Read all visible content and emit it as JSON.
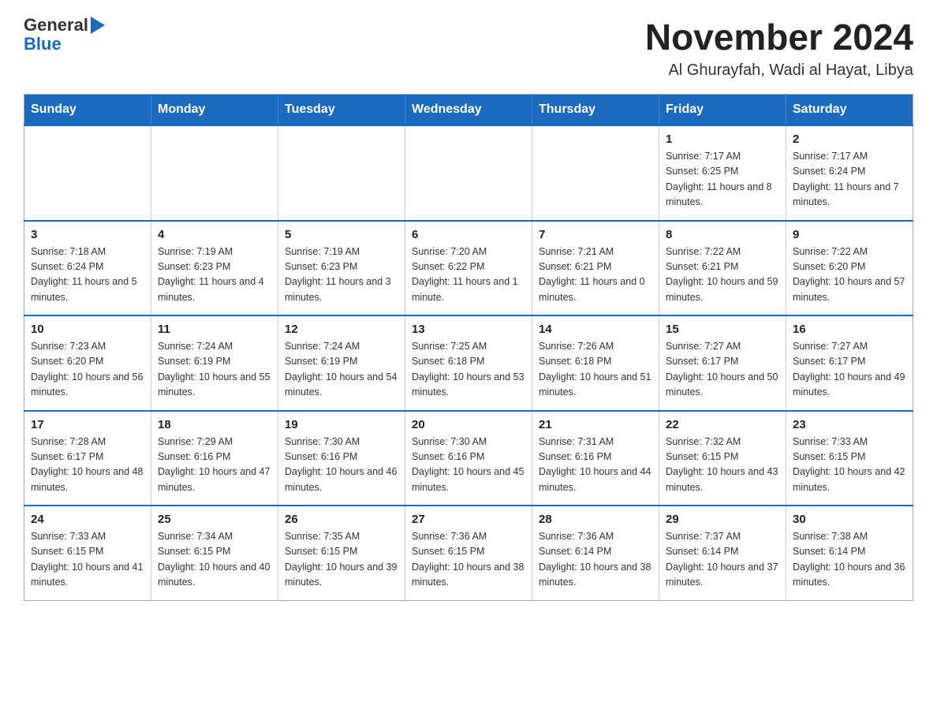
{
  "header": {
    "logo_general": "General",
    "logo_triangle": "▶",
    "logo_blue": "Blue",
    "month_title": "November 2024",
    "location": "Al Ghurayfah, Wadi al Hayat, Libya"
  },
  "weekdays": [
    "Sunday",
    "Monday",
    "Tuesday",
    "Wednesday",
    "Thursday",
    "Friday",
    "Saturday"
  ],
  "weeks": [
    [
      {
        "day": "",
        "info": ""
      },
      {
        "day": "",
        "info": ""
      },
      {
        "day": "",
        "info": ""
      },
      {
        "day": "",
        "info": ""
      },
      {
        "day": "",
        "info": ""
      },
      {
        "day": "1",
        "info": "Sunrise: 7:17 AM\nSunset: 6:25 PM\nDaylight: 11 hours and 8 minutes."
      },
      {
        "day": "2",
        "info": "Sunrise: 7:17 AM\nSunset: 6:24 PM\nDaylight: 11 hours and 7 minutes."
      }
    ],
    [
      {
        "day": "3",
        "info": "Sunrise: 7:18 AM\nSunset: 6:24 PM\nDaylight: 11 hours and 5 minutes."
      },
      {
        "day": "4",
        "info": "Sunrise: 7:19 AM\nSunset: 6:23 PM\nDaylight: 11 hours and 4 minutes."
      },
      {
        "day": "5",
        "info": "Sunrise: 7:19 AM\nSunset: 6:23 PM\nDaylight: 11 hours and 3 minutes."
      },
      {
        "day": "6",
        "info": "Sunrise: 7:20 AM\nSunset: 6:22 PM\nDaylight: 11 hours and 1 minute."
      },
      {
        "day": "7",
        "info": "Sunrise: 7:21 AM\nSunset: 6:21 PM\nDaylight: 11 hours and 0 minutes."
      },
      {
        "day": "8",
        "info": "Sunrise: 7:22 AM\nSunset: 6:21 PM\nDaylight: 10 hours and 59 minutes."
      },
      {
        "day": "9",
        "info": "Sunrise: 7:22 AM\nSunset: 6:20 PM\nDaylight: 10 hours and 57 minutes."
      }
    ],
    [
      {
        "day": "10",
        "info": "Sunrise: 7:23 AM\nSunset: 6:20 PM\nDaylight: 10 hours and 56 minutes."
      },
      {
        "day": "11",
        "info": "Sunrise: 7:24 AM\nSunset: 6:19 PM\nDaylight: 10 hours and 55 minutes."
      },
      {
        "day": "12",
        "info": "Sunrise: 7:24 AM\nSunset: 6:19 PM\nDaylight: 10 hours and 54 minutes."
      },
      {
        "day": "13",
        "info": "Sunrise: 7:25 AM\nSunset: 6:18 PM\nDaylight: 10 hours and 53 minutes."
      },
      {
        "day": "14",
        "info": "Sunrise: 7:26 AM\nSunset: 6:18 PM\nDaylight: 10 hours and 51 minutes."
      },
      {
        "day": "15",
        "info": "Sunrise: 7:27 AM\nSunset: 6:17 PM\nDaylight: 10 hours and 50 minutes."
      },
      {
        "day": "16",
        "info": "Sunrise: 7:27 AM\nSunset: 6:17 PM\nDaylight: 10 hours and 49 minutes."
      }
    ],
    [
      {
        "day": "17",
        "info": "Sunrise: 7:28 AM\nSunset: 6:17 PM\nDaylight: 10 hours and 48 minutes."
      },
      {
        "day": "18",
        "info": "Sunrise: 7:29 AM\nSunset: 6:16 PM\nDaylight: 10 hours and 47 minutes."
      },
      {
        "day": "19",
        "info": "Sunrise: 7:30 AM\nSunset: 6:16 PM\nDaylight: 10 hours and 46 minutes."
      },
      {
        "day": "20",
        "info": "Sunrise: 7:30 AM\nSunset: 6:16 PM\nDaylight: 10 hours and 45 minutes."
      },
      {
        "day": "21",
        "info": "Sunrise: 7:31 AM\nSunset: 6:16 PM\nDaylight: 10 hours and 44 minutes."
      },
      {
        "day": "22",
        "info": "Sunrise: 7:32 AM\nSunset: 6:15 PM\nDaylight: 10 hours and 43 minutes."
      },
      {
        "day": "23",
        "info": "Sunrise: 7:33 AM\nSunset: 6:15 PM\nDaylight: 10 hours and 42 minutes."
      }
    ],
    [
      {
        "day": "24",
        "info": "Sunrise: 7:33 AM\nSunset: 6:15 PM\nDaylight: 10 hours and 41 minutes."
      },
      {
        "day": "25",
        "info": "Sunrise: 7:34 AM\nSunset: 6:15 PM\nDaylight: 10 hours and 40 minutes."
      },
      {
        "day": "26",
        "info": "Sunrise: 7:35 AM\nSunset: 6:15 PM\nDaylight: 10 hours and 39 minutes."
      },
      {
        "day": "27",
        "info": "Sunrise: 7:36 AM\nSunset: 6:15 PM\nDaylight: 10 hours and 38 minutes."
      },
      {
        "day": "28",
        "info": "Sunrise: 7:36 AM\nSunset: 6:14 PM\nDaylight: 10 hours and 38 minutes."
      },
      {
        "day": "29",
        "info": "Sunrise: 7:37 AM\nSunset: 6:14 PM\nDaylight: 10 hours and 37 minutes."
      },
      {
        "day": "30",
        "info": "Sunrise: 7:38 AM\nSunset: 6:14 PM\nDaylight: 10 hours and 36 minutes."
      }
    ]
  ]
}
